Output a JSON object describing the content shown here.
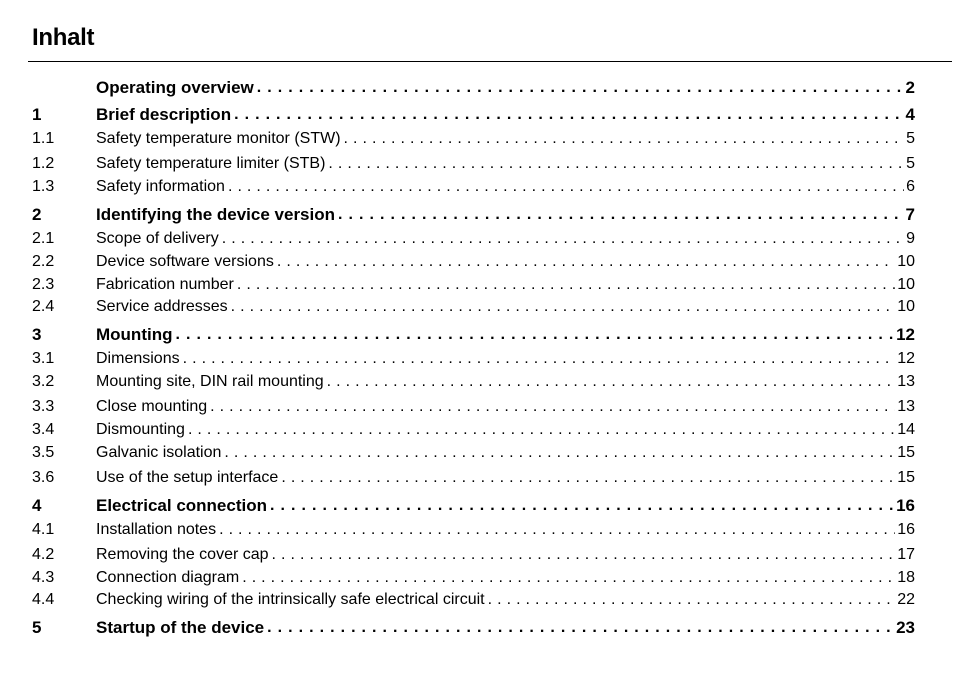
{
  "title": "Inhalt",
  "entries": [
    {
      "num": "",
      "label": "Operating overview",
      "page": "2",
      "level": "chapter"
    },
    {
      "num": "1",
      "label": "Brief description",
      "page": "4",
      "level": "chapter"
    },
    {
      "num": "1.1",
      "label": "Safety temperature monitor (STW)",
      "page": "5",
      "level": "section"
    },
    {
      "num": "1.2",
      "label": "Safety temperature limiter (STB)",
      "page": "5",
      "level": "section"
    },
    {
      "num": "1.3",
      "label": "Safety information",
      "page": "6",
      "level": "section"
    },
    {
      "num": "2",
      "label": "Identifying the device version",
      "page": "7",
      "level": "chapter"
    },
    {
      "num": "2.1",
      "label": "Scope of delivery",
      "page": "9",
      "level": "section"
    },
    {
      "num": "2.2",
      "label": "Device software versions",
      "page": "10",
      "level": "section"
    },
    {
      "num": "2.3",
      "label": "Fabrication number",
      "page": "10",
      "level": "section"
    },
    {
      "num": "2.4",
      "label": "Service addresses",
      "page": "10",
      "level": "section"
    },
    {
      "num": "3",
      "label": "Mounting",
      "page": "12",
      "level": "chapter"
    },
    {
      "num": "3.1",
      "label": "Dimensions",
      "page": "12",
      "level": "section"
    },
    {
      "num": "3.2",
      "label": "Mounting site, DIN rail mounting",
      "page": "13",
      "level": "section"
    },
    {
      "num": "3.3",
      "label": "Close mounting",
      "page": "13",
      "level": "section"
    },
    {
      "num": "3.4",
      "label": "Dismounting",
      "page": "14",
      "level": "section"
    },
    {
      "num": "3.5",
      "label": "Galvanic isolation",
      "page": "15",
      "level": "section"
    },
    {
      "num": "3.6",
      "label": "Use of the setup interface",
      "page": "15",
      "level": "section"
    },
    {
      "num": "4",
      "label": "Electrical connection",
      "page": "16",
      "level": "chapter"
    },
    {
      "num": "4.1",
      "label": "Installation notes",
      "page": "16",
      "level": "section"
    },
    {
      "num": "4.2",
      "label": "Removing the cover cap",
      "page": "17",
      "level": "section"
    },
    {
      "num": "4.3",
      "label": "Connection diagram",
      "page": "18",
      "level": "section"
    },
    {
      "num": "4.4",
      "label": "Checking wiring of the intrinsically safe electrical circuit",
      "page": "22",
      "level": "section"
    },
    {
      "num": "5",
      "label": "Startup of the device",
      "page": "23",
      "level": "chapter"
    }
  ]
}
